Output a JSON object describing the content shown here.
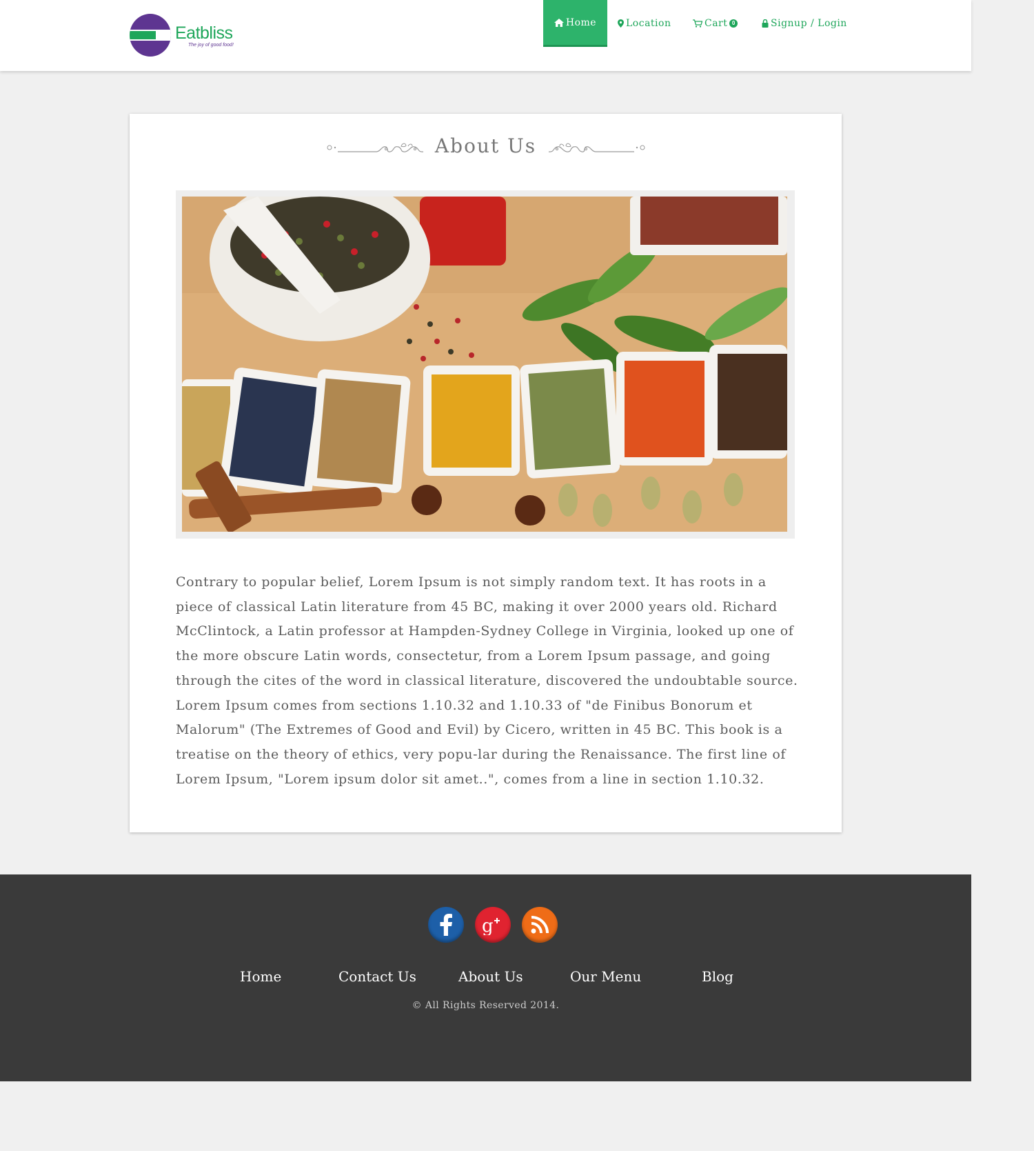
{
  "brand": {
    "name": "Eatbliss",
    "tagline": "The joy of good food!",
    "colors": {
      "green": "#1ea65a",
      "purple": "#5e3591",
      "nav_active": "#2db36b"
    }
  },
  "nav": {
    "items": [
      {
        "label": "Home",
        "icon": "home-icon",
        "active": true
      },
      {
        "label": "Location",
        "icon": "map-pin-icon",
        "active": false
      },
      {
        "label": "Cart",
        "icon": "cart-icon",
        "active": false,
        "badge": "0"
      },
      {
        "label": "Signup / Login",
        "icon": "lock-icon",
        "active": false
      }
    ]
  },
  "page": {
    "title": "About Us",
    "image_alt_icon": "spices-photo",
    "body": "Contrary to popular belief, Lorem Ipsum is not simply random text. It has roots in a piece of classical Latin literature from 45 BC, making it over 2000 years old. Richard McClintock, a Latin professor at Hampden-Sydney College in Virginia, looked up one of the more obscure Latin words, consectetur, from a Lorem Ipsum passage, and going through the cites of the word in classical literature, discovered the undoubtable source. Lorem Ipsum comes from sections 1.10.32 and 1.10.33 of \"de Finibus Bonorum et Malorum\" (The Extremes of Good and Evil) by Cicero, written in 45 BC. This book is a treatise on the theory of ethics, very popu-lar during the Renaissance. The first line of Lorem Ipsum, \"Lorem ipsum dolor sit amet..\", comes from a line in section 1.10.32."
  },
  "footer": {
    "social": [
      {
        "name": "facebook-icon",
        "color": "#1d5fa8"
      },
      {
        "name": "google-plus-icon",
        "color": "#e02330"
      },
      {
        "name": "rss-icon",
        "color": "#ef6c17"
      }
    ],
    "links": [
      "Home",
      "Contact Us",
      "About Us",
      "Our Menu",
      "Blog"
    ],
    "copyright": "© All Rights Reserved 2014."
  }
}
